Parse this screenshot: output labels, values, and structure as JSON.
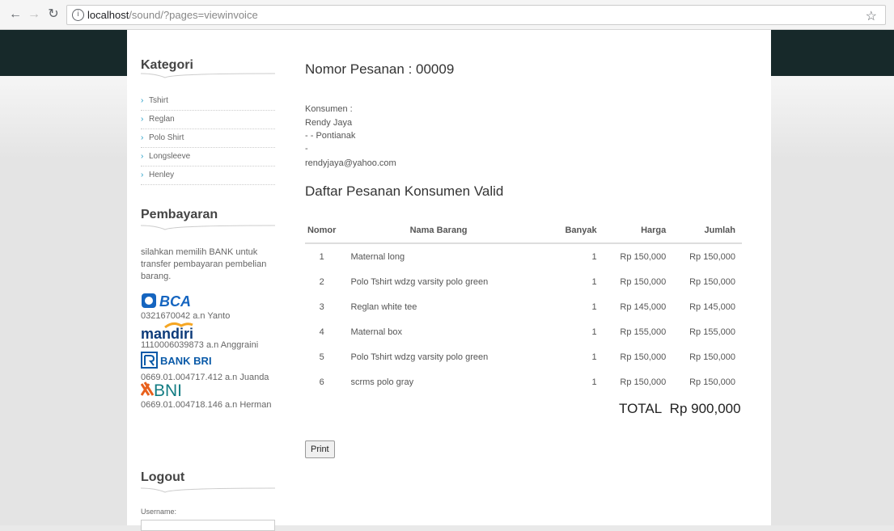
{
  "browser": {
    "url_host": "localhost",
    "url_path": "/sound/?pages=viewinvoice"
  },
  "sidebar": {
    "kategori_title": "Kategori",
    "categories": [
      "Tshirt",
      "Reglan",
      "Polo Shirt",
      "Longsleeve",
      "Henley"
    ],
    "pembayaran_title": "Pembayaran",
    "pembayaran_text": "silahkan memilih BANK untuk transfer pembayaran pembelian barang.",
    "banks": [
      {
        "logo": "BCA",
        "account": "0321670042 a.n Yanto",
        "color": "#1565c0"
      },
      {
        "logo": "mandiri",
        "account": "1110006039873 a.n Anggraini",
        "color": "#0d3b7a"
      },
      {
        "logo": "BANK BRI",
        "account": "0669.01.004717.412 a.n Juanda",
        "color": "#0a5aa8"
      },
      {
        "logo": "BNI",
        "account": "0669.01.004718.146 a.n Herman",
        "color": "#137c83"
      }
    ],
    "logout_title": "Logout",
    "username_label": "Username:"
  },
  "invoice": {
    "title": "Nomor Pesanan : 00009",
    "customer_label": "Konsumen :",
    "customer_name": "Rendy Jaya",
    "customer_address": "- - Pontianak",
    "customer_extra": "-",
    "customer_email": "rendyjaya@yahoo.com",
    "valid_title": "Daftar Pesanan Konsumen Valid",
    "columns": [
      "Nomor",
      "Nama Barang",
      "Banyak",
      "Harga",
      "Jumlah"
    ],
    "rows": [
      {
        "no": "1",
        "name": "Maternal long",
        "qty": "1",
        "price": "Rp 150,000",
        "total": "Rp 150,000"
      },
      {
        "no": "2",
        "name": "Polo Tshirt wdzg varsity polo green",
        "qty": "1",
        "price": "Rp 150,000",
        "total": "Rp 150,000"
      },
      {
        "no": "3",
        "name": "Reglan white tee",
        "qty": "1",
        "price": "Rp 145,000",
        "total": "Rp 145,000"
      },
      {
        "no": "4",
        "name": "Maternal box",
        "qty": "1",
        "price": "Rp 155,000",
        "total": "Rp 155,000"
      },
      {
        "no": "5",
        "name": "Polo Tshirt wdzg varsity polo green",
        "qty": "1",
        "price": "Rp 150,000",
        "total": "Rp 150,000"
      },
      {
        "no": "6",
        "name": "scrms polo gray",
        "qty": "1",
        "price": "Rp 150,000",
        "total": "Rp 150,000"
      }
    ],
    "total_label": "TOTAL",
    "total_value": "Rp 900,000",
    "print_label": "Print"
  }
}
